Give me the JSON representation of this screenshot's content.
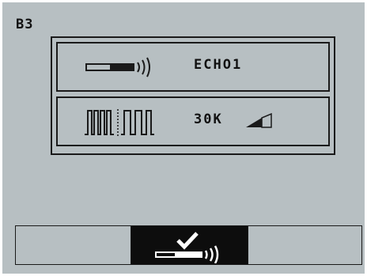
{
  "screen": {
    "id_label": "B3"
  },
  "rows": [
    {
      "icon": "probe-transmit-icon",
      "label": "ECHO1"
    },
    {
      "icon": "pulse-waveform-icon",
      "label": "30K",
      "extra_icon": "signal-strength-icon",
      "signal_level_bars": 2,
      "signal_max_bars": 3
    }
  ],
  "bottom_bar": {
    "segments": [
      {
        "state": "inactive"
      },
      {
        "state": "selected",
        "icon": "confirm-transmit-icon"
      },
      {
        "state": "inactive"
      }
    ]
  },
  "colors": {
    "screen_bg": "#b7bfc2",
    "ink": "#1a1a1a",
    "selected_bg": "#0d0d0d",
    "selected_fg": "#ffffff"
  }
}
